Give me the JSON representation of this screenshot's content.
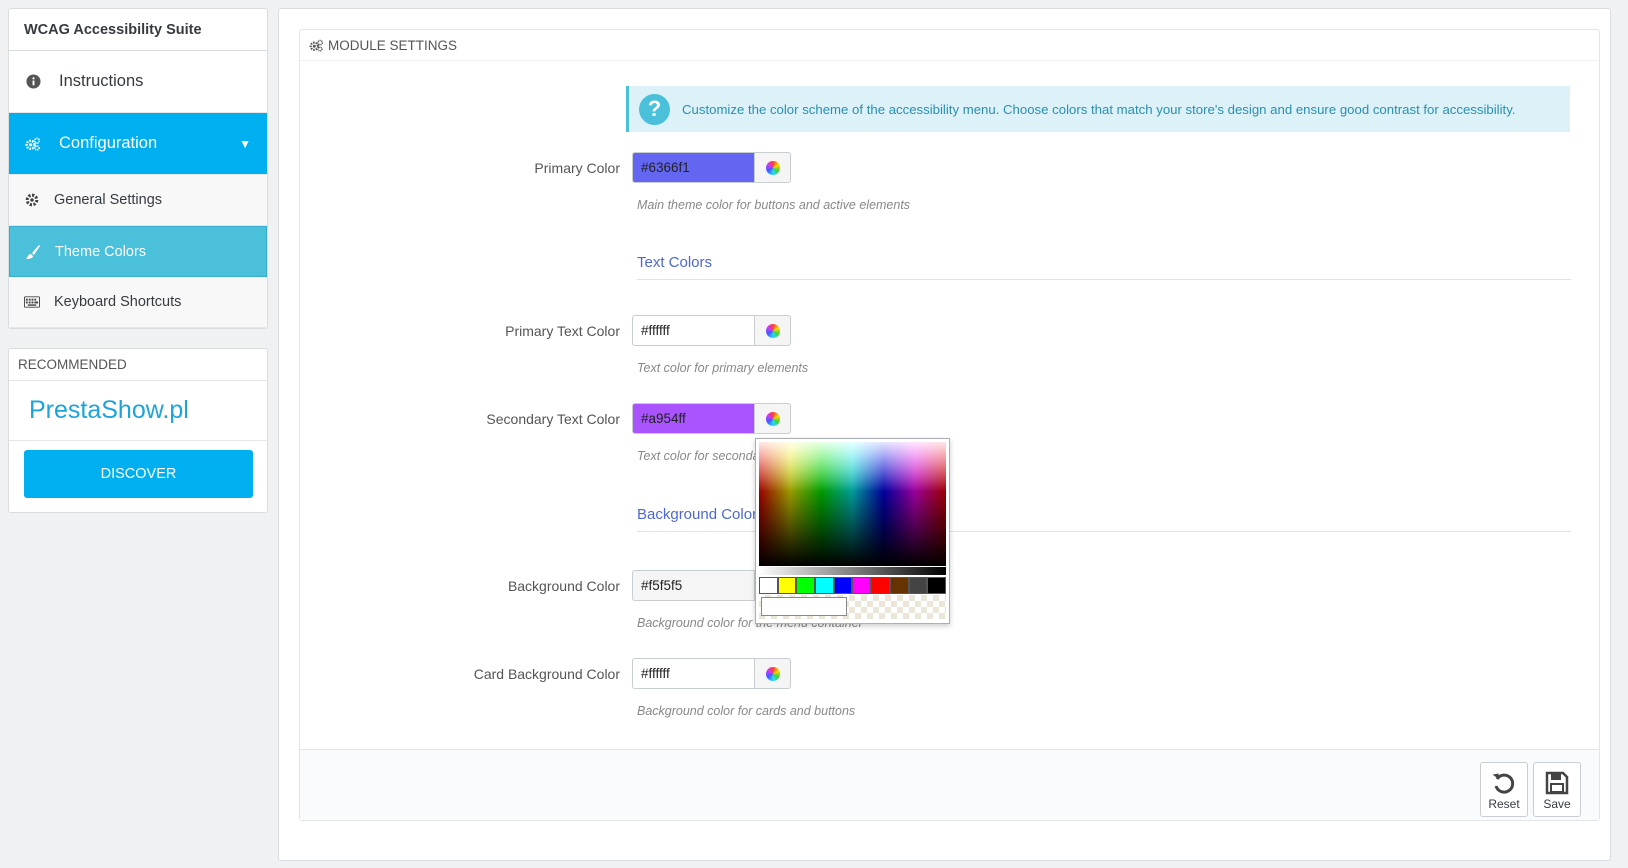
{
  "sidebar": {
    "title": "WCAG Accessibility Suite",
    "items": [
      {
        "label": "Instructions",
        "icon": "info-icon"
      },
      {
        "label": "Configuration",
        "icon": "cogs-icon",
        "caret": "▼"
      }
    ],
    "subitems": [
      {
        "label": "General Settings",
        "icon": "gear-icon"
      },
      {
        "label": "Theme Colors",
        "icon": "brush-icon"
      },
      {
        "label": "Keyboard Shortcuts",
        "icon": "keyboard-icon"
      }
    ],
    "recommended": {
      "heading": "RECOMMENDED",
      "brand": "PrestaShow.pl",
      "button": "DISCOVER"
    }
  },
  "panel": {
    "heading": "MODULE SETTINGS",
    "alert": "Customize the color scheme of the accessibility menu. Choose colors that match your store's design and ensure good contrast for accessibility.",
    "fields": {
      "primary": {
        "label": "Primary Color",
        "value": "#6366f1",
        "help": "Main theme color for buttons and active elements",
        "swatch": "#6366f1"
      },
      "text_section": "Text Colors",
      "primary_text": {
        "label": "Primary Text Color",
        "value": "#ffffff",
        "help": "Text color for primary elements",
        "swatch": "#ffffff"
      },
      "secondary_text": {
        "label": "Secondary Text Color",
        "value": "#a954ff",
        "help": "Text color for seconda",
        "swatch": "#a954ff"
      },
      "bg_section": "Background Color",
      "background": {
        "label": "Background Color",
        "value": "#f5f5f5",
        "help": "Background color for the menu container",
        "swatch": "#f5f5f5"
      },
      "card_bg": {
        "label": "Card Background Color",
        "value": "#ffffff",
        "help": "Background color for cards and buttons",
        "swatch": "#ffffff"
      }
    },
    "footer": {
      "reset": "Reset",
      "save": "Save"
    }
  },
  "colorpicker": {
    "swatches": [
      "#ffffff",
      "#ffff00",
      "#00ff00",
      "#00ffff",
      "#0000ff",
      "#ff00ff",
      "#ff0000",
      "#663300",
      "#444444",
      "#000000"
    ]
  },
  "colors": {
    "accent": "#00aff0",
    "selected_sub": "#4ac0db",
    "section_title": "#4f68d0"
  }
}
